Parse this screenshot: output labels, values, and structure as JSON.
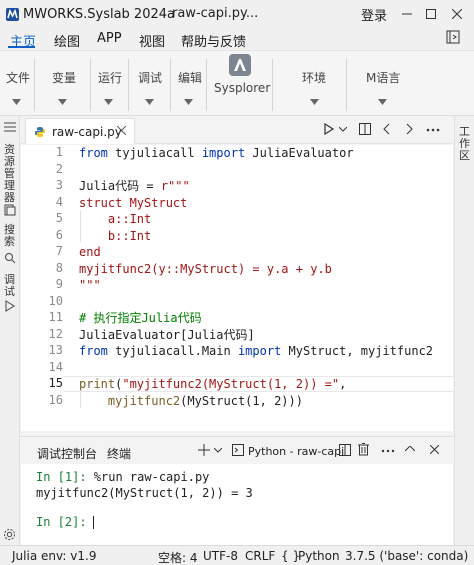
{
  "titlebar": {
    "app_title": "MWORKS.Syslab 2024a",
    "file_title": "raw-capi.py...",
    "login_label": "登录"
  },
  "menubar": {
    "items": [
      {
        "label": "主页",
        "active": true
      },
      {
        "label": "绘图"
      },
      {
        "label": "APP"
      },
      {
        "label": "视图"
      },
      {
        "label": "帮助与反馈"
      }
    ]
  },
  "ribbon": {
    "groups": [
      {
        "label": "文件"
      },
      {
        "label": "变量"
      },
      {
        "label": "运行"
      },
      {
        "label": "调试"
      },
      {
        "label": "编辑"
      },
      {
        "label": "Sysplorer"
      },
      {
        "label": "环境"
      },
      {
        "label": "M语言"
      }
    ]
  },
  "leftbar": {
    "explorer_label": "资源管理器",
    "search_label": "搜索",
    "debug_label": "调试"
  },
  "rightbar": {
    "workspace_label": "工作区"
  },
  "editor": {
    "tab_label": "raw-capi.py",
    "line_numbers": [
      "1",
      "2",
      "3",
      "4",
      "5",
      "6",
      "7",
      "8",
      "9",
      "10",
      "11",
      "12",
      "13",
      "14",
      "15",
      "16"
    ]
  },
  "panel": {
    "tab_debug_console": "调试控制台",
    "tab_terminal": "终端",
    "kernel_label": "Python - raw-capi"
  },
  "console": {
    "prompt1": "In [1]:",
    "cmd1": " %run raw-capi.py",
    "output1": "myjitfunc2(MyStruct(1, 2)) = 3",
    "prompt2": "In [2]:"
  },
  "statusbar": {
    "julia_env": "Julia env: v1.9",
    "spaces": "空格: 4",
    "encoding": "UTF-8",
    "eol": "CRLF",
    "language": "Python",
    "interpreter": "3.7.5 ('base': conda)"
  }
}
